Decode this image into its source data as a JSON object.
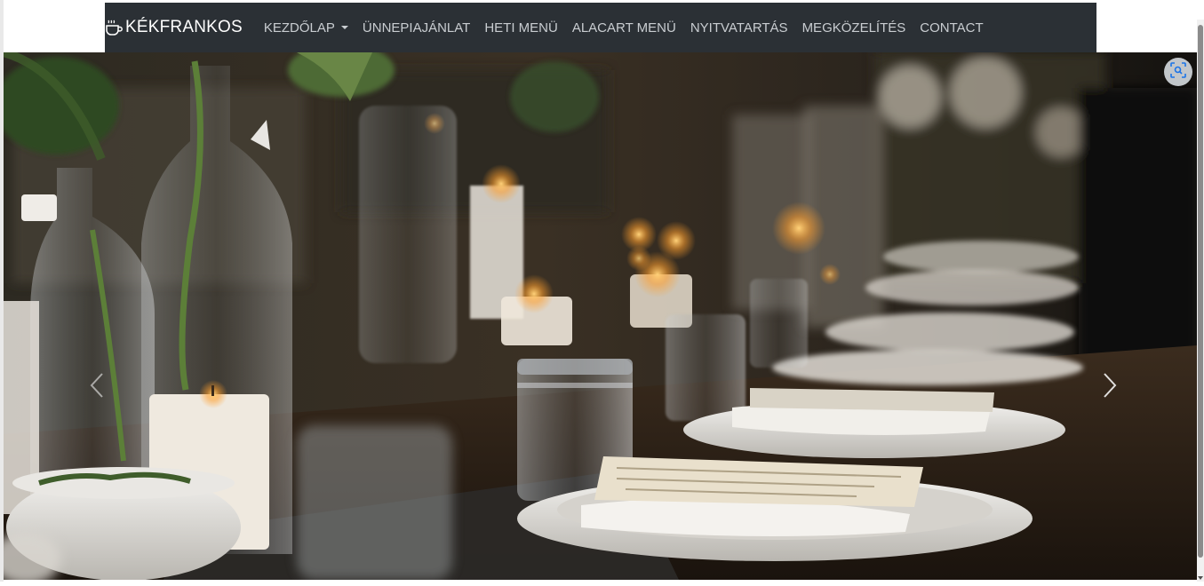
{
  "brand": {
    "name": "KÉKFRANKOS",
    "icon": "coffee-cup-icon"
  },
  "nav": {
    "items": [
      {
        "label": "KEZDŐLAP",
        "dropdown": true
      },
      {
        "label": "ÜNNEPIAJÁNLAT"
      },
      {
        "label": "HETI MENÜ"
      },
      {
        "label": "ALACART MENÜ"
      },
      {
        "label": "NYITVATARTÁS"
      },
      {
        "label": "MEGKÖZELÍTÉS"
      },
      {
        "label": "CONTACT"
      }
    ]
  },
  "hero": {
    "prev_icon": "chevron-left-icon",
    "next_icon": "chevron-right-icon"
  },
  "lens": {
    "icon": "visual-search-icon"
  },
  "colors": {
    "navbar": "#2b3035",
    "nav_text": "#c9cdd1",
    "brand_text": "#ffffff"
  }
}
